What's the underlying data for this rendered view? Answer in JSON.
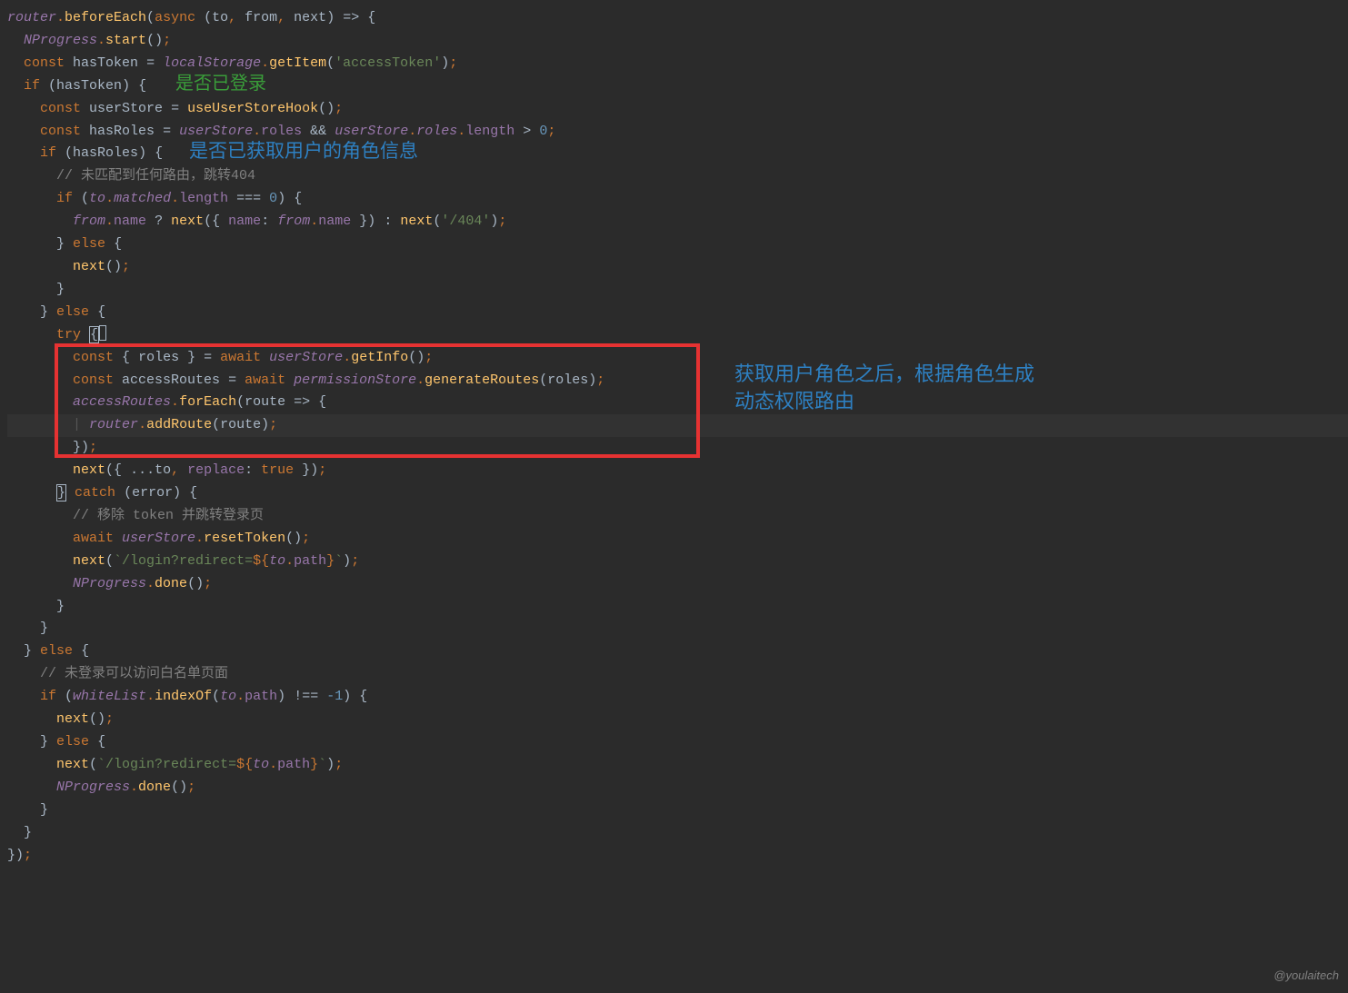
{
  "watermark": "@youlaitech",
  "annotations": {
    "green1": "是否已登录",
    "blue1": "是否已获取用户的角色信息",
    "blue_right_line1": "获取用户角色之后，根据角色生成",
    "blue_right_line2": "动态权限路由"
  },
  "code": {
    "l1_router": "router",
    "l1_beforeEach": "beforeEach",
    "l1_async": "async",
    "l1_to": "to",
    "l1_from": "from",
    "l1_next": "next",
    "l2_NProgress": "NProgress",
    "l2_start": "start",
    "l3_const": "const ",
    "l3_hasToken": "hasToken",
    "l3_localStorage": "localStorage",
    "l3_getItem": "getItem",
    "l3_str": "'accessToken'",
    "l4_if": "if ",
    "l4_hasToken": "hasToken",
    "l5_const": "const ",
    "l5_userStore": "userStore",
    "l5_hook": "useUserStoreHook",
    "l6_const": "const ",
    "l6_hasRoles": "hasRoles",
    "l6_userStore1": "userStore",
    "l6_roles1": "roles",
    "l6_userStore2": "userStore",
    "l6_roles2": "roles",
    "l6_length": "length",
    "l6_zero": "0",
    "l7_if": "if ",
    "l7_hasRoles": "hasRoles",
    "l8_comment": "// 未匹配到任何路由，跳转404",
    "l9_if": "if ",
    "l9_to": "to",
    "l9_matched": "matched",
    "l9_length": "length",
    "l9_zero": "0",
    "l10_from": "from",
    "l10_name1": "name",
    "l10_next1": "next",
    "l10_name2": "name",
    "l10_from2": "from",
    "l10_name3": "name",
    "l10_next2": "next",
    "l10_str404": "'/404'",
    "l11_else": "else ",
    "l12_next": "next",
    "l14_else": "else ",
    "l15_try": "try ",
    "l16_const": "const ",
    "l16_roles": "roles",
    "l16_await": "await ",
    "l16_userStore": "userStore",
    "l16_getInfo": "getInfo",
    "l17_const": "const ",
    "l17_accessRoutes": "accessRoutes",
    "l17_await": "await ",
    "l17_permissionStore": "permissionStore",
    "l17_generateRoutes": "generateRoutes",
    "l17_roles": "roles",
    "l18_accessRoutes": "accessRoutes",
    "l18_forEach": "forEach",
    "l18_route": "route",
    "l19_router": "router",
    "l19_addRoute": "addRoute",
    "l19_route": "route",
    "l21_next": "next",
    "l21_to": "to",
    "l21_replace": "replace",
    "l21_true": "true ",
    "l22_catch": "catch ",
    "l22_error": "error",
    "l23_comment": "// 移除 token 并跳转登录页",
    "l24_await": "await ",
    "l24_userStore": "userStore",
    "l24_resetToken": "resetToken",
    "l25_next": "next",
    "l25_tmpl1": "`/login?redirect=",
    "l25_to": "to",
    "l25_path": "path",
    "l25_tmpl2": "`",
    "l26_NProgress": "NProgress",
    "l26_done": "done",
    "l29_else": "else ",
    "l30_comment": "// 未登录可以访问白名单页面",
    "l31_if": "if ",
    "l31_whiteList": "whiteList",
    "l31_indexOf": "indexOf",
    "l31_to": "to",
    "l31_path": "path",
    "l31_neg1": "-1",
    "l32_next": "next",
    "l33_else": "else ",
    "l34_next": "next",
    "l34_tmpl1": "`/login?redirect=",
    "l34_to": "to",
    "l34_path": "path",
    "l34_tmpl2": "`",
    "l35_NProgress": "NProgress",
    "l35_done": "done"
  }
}
